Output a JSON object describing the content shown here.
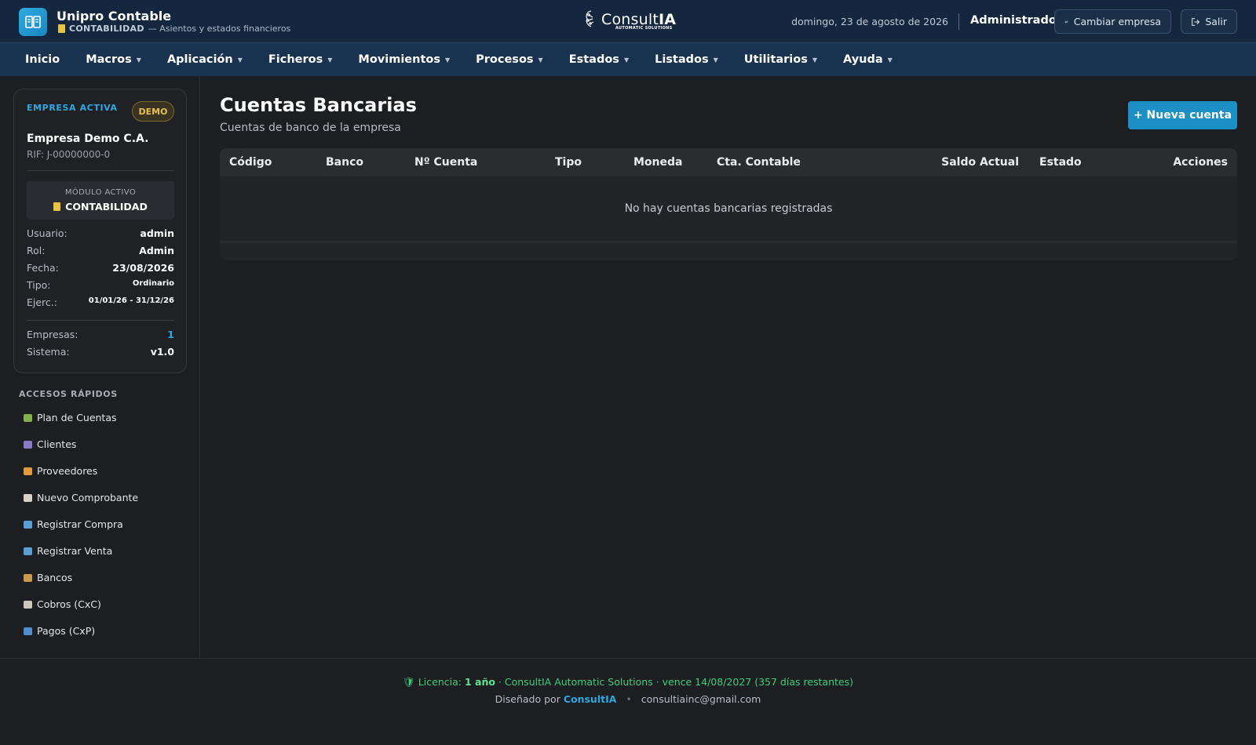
{
  "app": {
    "title": "Unipro Contable",
    "module": "CONTABILIDAD",
    "module_desc": "— Asientos y estados financieros"
  },
  "logo": {
    "name_part": "Consult",
    "name_bold": "IA",
    "tagline": "AUTOMATIC SOLUTIONS"
  },
  "header": {
    "date": "domingo, 23 de agosto de 2026",
    "user": "Administrador",
    "switch_label": "Cambiar empresa",
    "exit_label": "Salir"
  },
  "menu": [
    {
      "label": "Inicio",
      "caret": false
    },
    {
      "label": "Macros",
      "caret": true
    },
    {
      "label": "Aplicación",
      "caret": true
    },
    {
      "label": "Ficheros",
      "caret": true
    },
    {
      "label": "Movimientos",
      "caret": true
    },
    {
      "label": "Procesos",
      "caret": true
    },
    {
      "label": "Estados",
      "caret": true
    },
    {
      "label": "Listados",
      "caret": true
    },
    {
      "label": "Utilitarios",
      "caret": true
    },
    {
      "label": "Ayuda",
      "caret": true
    }
  ],
  "sidebar": {
    "card_label": "EMPRESA ACTIVA",
    "badge": "DEMO",
    "company": "Empresa Demo C.A.",
    "rif": "RIF: J-00000000-0",
    "module_label": "MÓDULO ACTIVO",
    "module_value": "CONTABILIDAD",
    "info": [
      {
        "k": "Usuario:",
        "v": "admin"
      },
      {
        "k": "Rol:",
        "v": "Admin"
      },
      {
        "k": "Fecha:",
        "v": "23/08/2026"
      },
      {
        "k": "Tipo:",
        "v": "Ordinario"
      },
      {
        "k": "Ejerc.:",
        "v": "01/01/26 - 31/12/26"
      }
    ],
    "stats": [
      {
        "k": "Empresas:",
        "v": "1"
      },
      {
        "k": "Sistema:",
        "v": "v1.0"
      }
    ],
    "quick_title": "ACCESOS RÁPIDOS",
    "quick": [
      {
        "label": "Plan de Cuentas",
        "icon": "books-icon",
        "color": "#7fb04a"
      },
      {
        "label": "Clientes",
        "icon": "users-icon",
        "color": "#8a78c9"
      },
      {
        "label": "Proveedores",
        "icon": "truck-icon",
        "color": "#e29a3a"
      },
      {
        "label": "Nuevo Comprobante",
        "icon": "document-icon",
        "color": "#d9d1c6"
      },
      {
        "label": "Registrar Compra",
        "icon": "register-icon",
        "color": "#5a9fd6"
      },
      {
        "label": "Registrar Venta",
        "icon": "register-icon",
        "color": "#5a9fd6"
      },
      {
        "label": "Bancos",
        "icon": "money-bag-icon",
        "color": "#c99a4a"
      },
      {
        "label": "Cobros (CxC)",
        "icon": "receipt-icon",
        "color": "#cfc7bb"
      },
      {
        "label": "Pagos (CxP)",
        "icon": "credit-card-icon",
        "color": "#4f8fd1"
      }
    ]
  },
  "main": {
    "title": "Cuentas Bancarias",
    "subtitle": "Cuentas de banco de la empresa",
    "new_button": "+ Nueva cuenta",
    "columns": [
      "Código",
      "Banco",
      "Nº Cuenta",
      "Tipo",
      "Moneda",
      "Cta. Contable",
      "Saldo Actual",
      "Estado",
      "Acciones"
    ],
    "empty_text": "No hay cuentas bancarias registradas"
  },
  "footer": {
    "license_prefix": "Licencia:",
    "license_term": "1 año",
    "license_rest": "· ConsultIA Automatic Solutions · vence 14/08/2027 (357 días restantes)",
    "designed_by": "Diseñado por",
    "brand": "ConsultIA",
    "email": "consultiainc@gmail.com"
  }
}
